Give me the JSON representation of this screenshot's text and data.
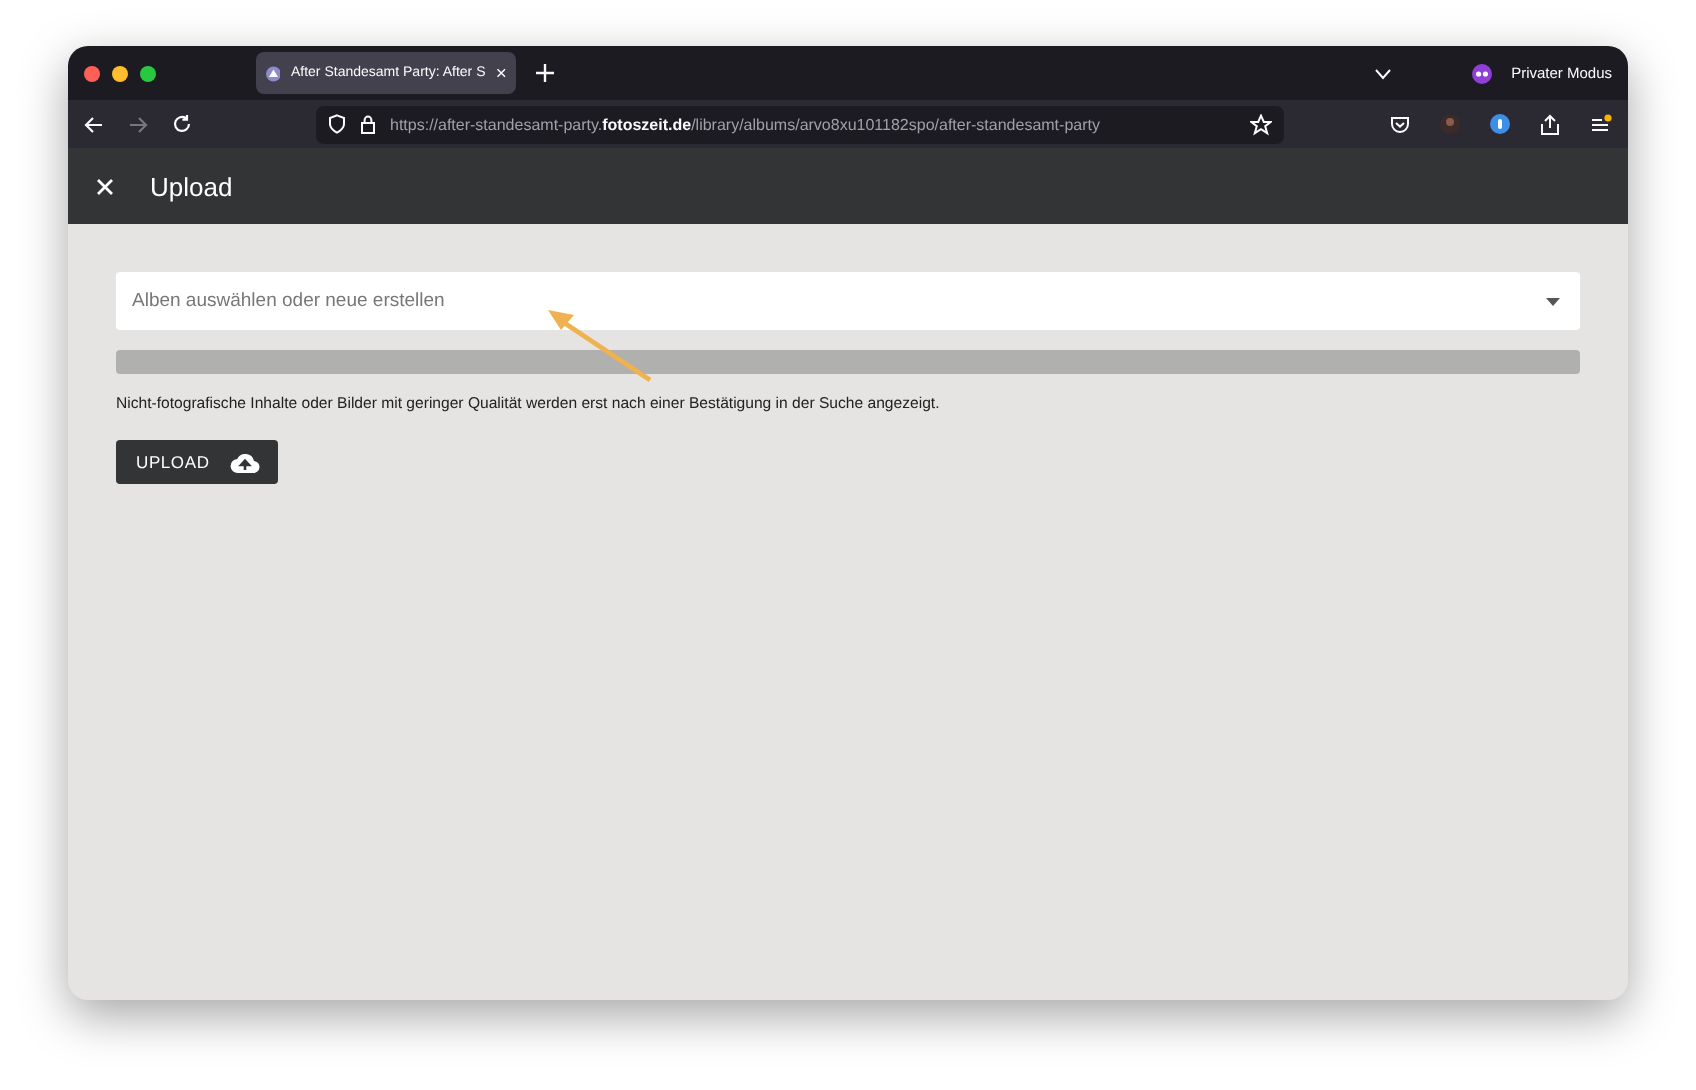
{
  "browser": {
    "tab": {
      "title": "After Standesamt Party: After S",
      "selected": true
    },
    "private_mode": "Privater Modus",
    "url": "https://after-standesamt-party.**fotoszeit.de**/library/albums/arvo8xu101182spo/after-standesamt-party"
  },
  "app_bar": {
    "title": "Upload"
  },
  "album_select": {
    "placeholder": "Alben auswählen oder neue erstellen"
  },
  "progress": {
    "level": 0
  },
  "notice": "Nicht-fotografische Inhalte oder Bilder mit geringer Qualität werden erst nach einer Bestätigung in der Suche angezeigt.",
  "upload_button": {
    "label": "UPLOAD"
  }
}
